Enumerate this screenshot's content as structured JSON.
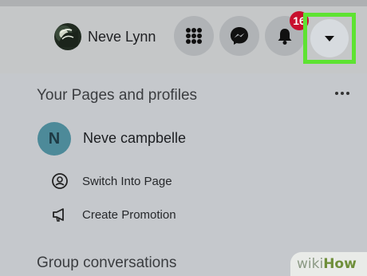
{
  "header": {
    "profile_name": "Neve Lynn",
    "icons": [
      "menu-grid-icon",
      "messenger-icon",
      "bell-icon",
      "caret-down-icon"
    ],
    "notifications_badge": "16"
  },
  "panel": {
    "pages_title": "Your Pages and profiles",
    "page": {
      "initial": "N",
      "name": "Neve campbelle"
    },
    "actions": [
      {
        "label": "Switch Into Page",
        "icon": "switch-profile-icon"
      },
      {
        "label": "Create Promotion",
        "icon": "megaphone-icon"
      }
    ],
    "group_title": "Group conversations"
  },
  "watermark": {
    "part1": "wiki",
    "part2": "How"
  },
  "colors": {
    "highlight": "#5ee332",
    "badge": "#c8102e",
    "page_avatar": "#4d8a99"
  }
}
